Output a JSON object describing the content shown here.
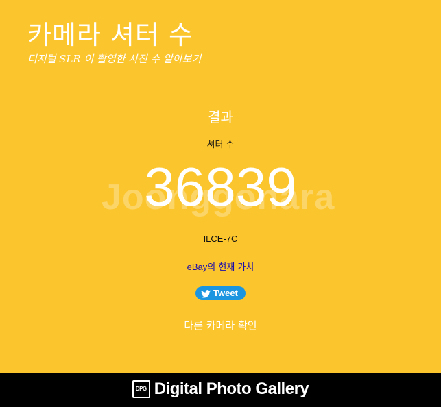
{
  "header": {
    "title": "카메라 셔터 수",
    "subtitle": "디지털 SLR 이 촬영한 사진 수 알아보기"
  },
  "result": {
    "heading": "결과",
    "shutter_label": "셔터 수",
    "shutter_count": "36839",
    "camera_model": "ILCE-7C",
    "ebay_brand": "eBay",
    "ebay_suffix": "의 현재 가치",
    "tweet_label": "Tweet",
    "check_other_label": "다른 카메라 확인"
  },
  "footer": {
    "logo_text": "DPG",
    "brand_name": "Digital Photo Gallery"
  },
  "watermark": "Joonggonara",
  "colors": {
    "background": "#fbc52e",
    "footer": "#000000",
    "link": "#1a0dab",
    "tweet": "#1b95e0"
  }
}
